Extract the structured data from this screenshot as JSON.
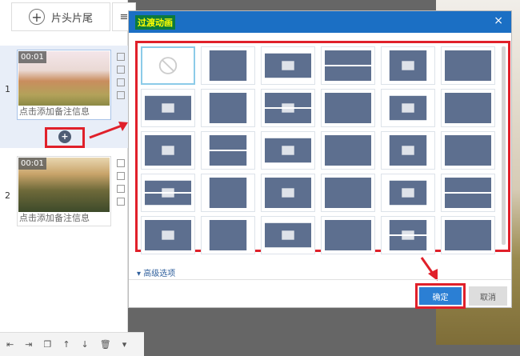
{
  "left_panel": {
    "intro_outro_label": "片头片尾",
    "slides": [
      {
        "index": "1",
        "time": "00:01",
        "note": "点击添加备注信息"
      },
      {
        "index": "2",
        "time": "00:01",
        "note": "点击添加备注信息"
      }
    ]
  },
  "dialog": {
    "title": "过渡动画",
    "close": "×",
    "tiles": [
      "none",
      "push-right",
      "wave",
      "checkerboard",
      "pinwheel",
      "circle",
      "ripple",
      "dots-grid",
      "hand-swipe",
      "dissolve",
      "door-open",
      "fade-box",
      "zigzag-left",
      "expand-cross",
      "blinds-horizontal",
      "expand-in",
      "lines",
      "diamond-expand",
      "scatter",
      "trapezoid",
      "cube",
      "flip",
      "vertical-blinds",
      "shatter",
      "split-horizontal",
      "arc",
      "split-vertical",
      "bowtie",
      "perspective",
      "fold"
    ],
    "advanced_label": "高级选项",
    "ok_label": "确定",
    "cancel_label": "取消"
  },
  "colors": {
    "accent": "#1b6fc4",
    "highlight": "#e0202a",
    "tile": "#5d6f8f"
  }
}
